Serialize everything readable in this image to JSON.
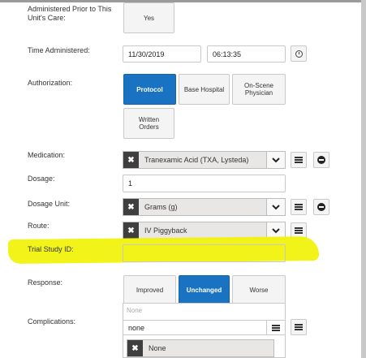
{
  "fields": {
    "administered_prior": {
      "label": "Administered Prior to This Unit's Care:",
      "yes": "Yes"
    },
    "time_administered": {
      "label": "Time Administered:",
      "date": "11/30/2019",
      "time": "06:13:35"
    },
    "authorization": {
      "label": "Authorization:",
      "options": [
        "Protocol",
        "Base Hospital",
        "On-Scene Physician",
        "Written Orders"
      ],
      "selected": "Protocol"
    },
    "medication": {
      "label": "Medication:",
      "value": "Tranexamic Acid (TXA, Lysteda)"
    },
    "dosage": {
      "label": "Dosage:",
      "value": "1"
    },
    "dosage_unit": {
      "label": "Dosage Unit:",
      "value": "Grams (g)"
    },
    "route": {
      "label": "Route:",
      "value": "IV Piggyback"
    },
    "trial_study_id": {
      "label": "Trial Study ID:",
      "value": ""
    },
    "response": {
      "label": "Response:",
      "options": [
        "Improved",
        "Unchanged",
        "Worse"
      ],
      "selected": "Unchanged"
    },
    "complications": {
      "label": "Complications:",
      "placeholder": "None",
      "search_value": "none",
      "selected_tag": "None"
    }
  },
  "colors": {
    "accent": "#1a73c2",
    "highlight": "#f1f20c"
  }
}
